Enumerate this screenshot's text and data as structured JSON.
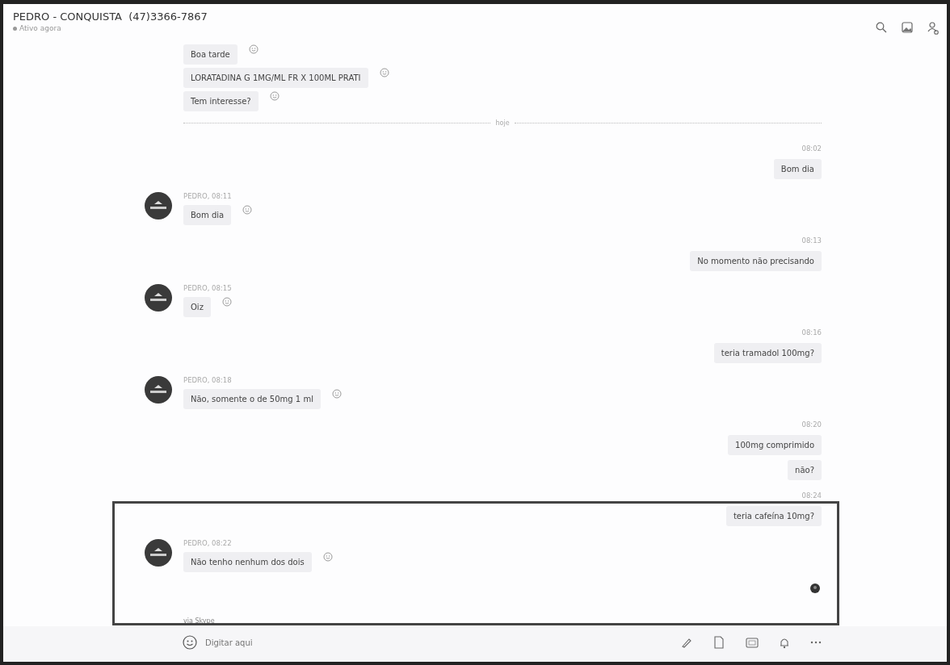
{
  "header": {
    "title": "PEDRO - CONQUISTA  (47)3366-7867",
    "status": "Ativo agora"
  },
  "messages": [
    {
      "kind": "in",
      "text": "Boa tarde"
    },
    {
      "kind": "in",
      "text": "LORATADINA G 1MG/ML FR X 100ML PRATI"
    },
    {
      "kind": "in",
      "text": "Tem interesse?"
    },
    {
      "kind": "divider",
      "text": "hoje"
    },
    {
      "kind": "out",
      "time": "08:02",
      "text": "Bom dia"
    },
    {
      "kind": "in",
      "sender": "PEDRO, 08:11",
      "text": "Bom dia"
    },
    {
      "kind": "out",
      "time": "08:13",
      "text": "No momento não precisando"
    },
    {
      "kind": "in",
      "sender": "PEDRO, 08:15",
      "text": "Oiz"
    },
    {
      "kind": "out",
      "time": "08:16",
      "text": "teria tramadol 100mg?"
    },
    {
      "kind": "in",
      "sender": "PEDRO, 08:18",
      "text": "Não, somente o de 50mg 1 ml"
    },
    {
      "kind": "out",
      "time": "08:20",
      "text": "100mg comprimido"
    },
    {
      "kind": "out",
      "text": "não?"
    },
    {
      "kind": "out",
      "time": "08:24",
      "text": "teria cafeína 10mg?"
    },
    {
      "kind": "in",
      "sender": "PEDRO, 08:22",
      "text": "Não tenho nenhum dos dois"
    }
  ],
  "footnote": "via Skype",
  "composer": {
    "placeholder": "Digitar aqui"
  }
}
